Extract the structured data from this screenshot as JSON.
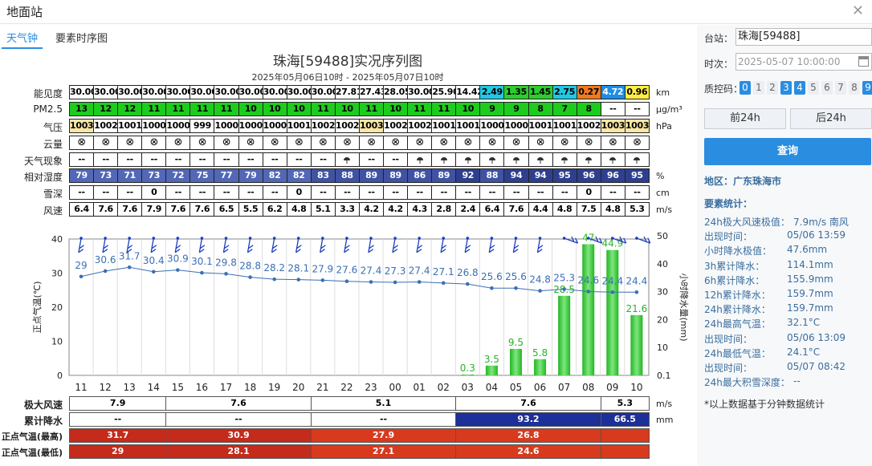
{
  "window": {
    "title": "地面站"
  },
  "tabs": [
    {
      "label": "天气钟",
      "active": true
    },
    {
      "label": "要素时序图",
      "active": false
    }
  ],
  "chart_header": {
    "title": "珠海[59488]实况序列图",
    "subtitle": "2025年05月06日10时 - 2025年05月07日10时"
  },
  "grid": {
    "visibility": {
      "label": "能见度",
      "unit": "km",
      "values": [
        "30.00",
        "30.00",
        "30.00",
        "30.00",
        "30.00",
        "30.00",
        "30.00",
        "30.00",
        "30.00",
        "30.00",
        "30.00",
        "27.81",
        "27.43",
        "28.05",
        "30.00",
        "25.90",
        "14.42",
        "2.49",
        "1.35",
        "1.45",
        "2.75",
        "0.27",
        "4.72",
        "0.96"
      ],
      "colors": [
        "#fff",
        "#fff",
        "#fff",
        "#fff",
        "#fff",
        "#fff",
        "#fff",
        "#fff",
        "#fff",
        "#fff",
        "#fff",
        "#fff",
        "#fff",
        "#fff",
        "#fff",
        "#fff",
        "#fff",
        "#22c7e3",
        "#2ecc2e",
        "#2ecc2e",
        "#22c7e3",
        "#ee7a1d",
        "#1e8de6",
        "#ffee44"
      ]
    },
    "pm25": {
      "label": "PM2.5",
      "unit": "μg/m³",
      "values": [
        "13",
        "12",
        "12",
        "11",
        "11",
        "11",
        "11",
        "10",
        "10",
        "10",
        "11",
        "10",
        "11",
        "10",
        "11",
        "11",
        "10",
        "9",
        "9",
        "8",
        "7",
        "8",
        "--",
        "--"
      ],
      "colors": [
        "#1ecc1e",
        "#1ecc1e",
        "#1ecc1e",
        "#1ecc1e",
        "#1ecc1e",
        "#1ecc1e",
        "#1ecc1e",
        "#1ecc1e",
        "#1ecc1e",
        "#1ecc1e",
        "#1ecc1e",
        "#1ecc1e",
        "#1ecc1e",
        "#1ecc1e",
        "#1ecc1e",
        "#1ecc1e",
        "#1ecc1e",
        "#1ecc1e",
        "#1ecc1e",
        "#1ecc1e",
        "#1ecc1e",
        "#1ecc1e",
        "#fff",
        "#fff"
      ]
    },
    "pressure": {
      "label": "气压",
      "unit": "hPa",
      "values": [
        "1003",
        "1002",
        "1001",
        "1000",
        "1000",
        "999",
        "1000",
        "1000",
        "1000",
        "1001",
        "1002",
        "1002",
        "1003",
        "1002",
        "1002",
        "1001",
        "1001",
        "1000",
        "1000",
        "1001",
        "1001",
        "1002",
        "1003",
        "1003"
      ],
      "colors": [
        "#f8e6a4",
        "#fff",
        "#fff",
        "#fff",
        "#fff",
        "#fff",
        "#fff",
        "#fff",
        "#fff",
        "#fff",
        "#fff",
        "#fff",
        "#f8e6a4",
        "#fff",
        "#fff",
        "#fff",
        "#fff",
        "#fff",
        "#fff",
        "#fff",
        "#fff",
        "#fff",
        "#f8e6a4",
        "#f8e6a4"
      ]
    },
    "cloud": {
      "label": "云量",
      "unit": "",
      "symbol": "⊗",
      "count": 24
    },
    "weather": {
      "label": "天气现象",
      "unit": "",
      "values": [
        "--",
        "--",
        "--",
        "--",
        "--",
        "--",
        "--",
        "--",
        "--",
        "--",
        "--",
        "rain",
        "--",
        "--",
        "rain",
        "rain",
        "rain",
        "rain",
        "rain",
        "rain",
        "rain",
        "rain",
        "rain",
        "rain"
      ]
    },
    "humidity": {
      "label": "相对湿度",
      "unit": "%",
      "values": [
        "79",
        "73",
        "71",
        "73",
        "72",
        "75",
        "77",
        "79",
        "82",
        "82",
        "83",
        "88",
        "89",
        "89",
        "86",
        "89",
        "92",
        "88",
        "94",
        "94",
        "95",
        "96",
        "96",
        "95"
      ],
      "colors": [
        "#5267b5",
        "#5267b5",
        "#5267b5",
        "#5267b5",
        "#5267b5",
        "#5267b5",
        "#5267b5",
        "#5267b5",
        "#5267b5",
        "#5267b5",
        "#3f52a3",
        "#3f52a3",
        "#3f52a3",
        "#3f52a3",
        "#3f52a3",
        "#3f52a3",
        "#2e3f8e",
        "#3f52a3",
        "#2e3f8e",
        "#2e3f8e",
        "#2e3f8e",
        "#2e3f8e",
        "#2e3f8e",
        "#2e3f8e"
      ]
    },
    "snow": {
      "label": "雪深",
      "unit": "cm",
      "values": [
        "--",
        "--",
        "--",
        "0",
        "--",
        "--",
        "--",
        "--",
        "--",
        "0",
        "--",
        "--",
        "--",
        "--",
        "--",
        "--",
        "--",
        "--",
        "--",
        "--",
        "--",
        "0",
        "--",
        "--"
      ]
    },
    "wind": {
      "label": "风速",
      "unit": "m/s",
      "values": [
        "6.4",
        "7.6",
        "7.6",
        "7.9",
        "7.6",
        "7.6",
        "6.5",
        "5.5",
        "6.2",
        "4.8",
        "5.1",
        "3.3",
        "4.2",
        "4.2",
        "4.3",
        "2.8",
        "2.4",
        "6.4",
        "7.6",
        "4.4",
        "4.8",
        "7.5",
        "4.8",
        "5.3"
      ]
    }
  },
  "chart_data": {
    "type": "line",
    "x": [
      "11",
      "12",
      "13",
      "14",
      "15",
      "16",
      "17",
      "18",
      "19",
      "20",
      "21",
      "22",
      "23",
      "00",
      "01",
      "02",
      "03",
      "04",
      "05",
      "06",
      "07",
      "08",
      "09",
      "10"
    ],
    "ylabel": "正点气温(℃)",
    "y2label": "小时降水量(mm)",
    "ylim": [
      0,
      40
    ],
    "y_ticks": [
      "0",
      "10",
      "20",
      "30",
      "40"
    ],
    "y2_ticks": [
      "0.1",
      "10",
      "20",
      "30",
      "40",
      "50"
    ],
    "series": [
      {
        "values": [
          29,
          30.6,
          31.7,
          30.4,
          30.9,
          30.1,
          29.8,
          28.8,
          28.2,
          28.1,
          27.9,
          27.6,
          27.4,
          27.3,
          27.4,
          27.1,
          26.8,
          25.6,
          25.6,
          24.8,
          25.3,
          24.6,
          24.4,
          24.4
        ],
        "color": "#3a6fb4"
      },
      {
        "type": "bar",
        "values": [
          null,
          null,
          null,
          null,
          null,
          null,
          null,
          null,
          null,
          null,
          null,
          null,
          null,
          null,
          null,
          null,
          0.3,
          3.5,
          9.5,
          5.8,
          28.5,
          47,
          44.9,
          21.6
        ],
        "color": "#2ec82e"
      }
    ],
    "grid": true
  },
  "bottom": {
    "rows": [
      {
        "label": "极大风速",
        "cells": [
          {
            "text": "7.9",
            "bg": "#fff",
            "fg": "#000"
          },
          {
            "text": "7.6",
            "bg": "#fff",
            "fg": "#000"
          },
          {
            "text": "5.1",
            "bg": "#fff",
            "fg": "#000"
          },
          {
            "text": "7.6",
            "bg": "#fff",
            "fg": "#000"
          },
          {
            "text": "5.3",
            "bg": "#fff",
            "fg": "#000"
          }
        ],
        "unit": "m/s"
      },
      {
        "label": "累计降水",
        "cells": [
          {
            "text": "--",
            "bg": "#fff",
            "fg": "#000"
          },
          {
            "text": "--",
            "bg": "#fff",
            "fg": "#000"
          },
          {
            "text": "--",
            "bg": "#fff",
            "fg": "#000"
          },
          {
            "text": "93.2",
            "bg": "#1d2f98",
            "fg": "#fff"
          },
          {
            "text": "66.5",
            "bg": "#1d2f98",
            "fg": "#fff"
          }
        ],
        "unit": "mm"
      },
      {
        "label": "正点气温(最高)",
        "cells": [
          {
            "text": "31.7",
            "bg": "#c42b1c",
            "fg": "#fff"
          },
          {
            "text": "30.9",
            "bg": "#c42b1c",
            "fg": "#fff"
          },
          {
            "text": "27.9",
            "bg": "#d83a1e",
            "fg": "#fff"
          },
          {
            "text": "26.8",
            "bg": "#d83a1e",
            "fg": "#fff"
          },
          {
            "text": "",
            "bg": "#d83a1e",
            "fg": "#fff"
          }
        ],
        "unit": ""
      },
      {
        "label": "正点气温(最低)",
        "cells": [
          {
            "text": "29",
            "bg": "#c42b1c",
            "fg": "#fff"
          },
          {
            "text": "28.1",
            "bg": "#c42b1c",
            "fg": "#fff"
          },
          {
            "text": "27.1",
            "bg": "#d83a1e",
            "fg": "#fff"
          },
          {
            "text": "24.6",
            "bg": "#d83a1e",
            "fg": "#fff"
          },
          {
            "text": "",
            "bg": "#d83a1e",
            "fg": "#fff"
          }
        ],
        "unit": ""
      }
    ]
  },
  "sidebar": {
    "station_label": "台站：",
    "station_value": "珠海[59488]",
    "time_label": "时次：",
    "time_value": "2025-05-07 10:00:00",
    "qc_label": "质控码：",
    "qc_codes": [
      {
        "v": "0",
        "on": true
      },
      {
        "v": "1",
        "on": false
      },
      {
        "v": "2",
        "on": false
      },
      {
        "v": "3",
        "on": true
      },
      {
        "v": "4",
        "on": true
      },
      {
        "v": "5",
        "on": false
      },
      {
        "v": "6",
        "on": false
      },
      {
        "v": "7",
        "on": false
      },
      {
        "v": "8",
        "on": false
      },
      {
        "v": "9",
        "on": true
      }
    ],
    "prev_label": "前24h",
    "next_label": "后24h",
    "query_label": "查询",
    "region": "地区：广东珠海市",
    "stats_title": "要素统计：",
    "stats": [
      {
        "k": "24h极大风速极值：",
        "v": "7.9m/s 南风"
      },
      {
        "k": "出现时间：",
        "v": "05/06 13:59"
      },
      {
        "k": "小时降水极值：",
        "v": "47.6mm"
      },
      {
        "k": "3h累计降水：",
        "v": "114.1mm"
      },
      {
        "k": "6h累计降水：",
        "v": "155.9mm"
      },
      {
        "k": "12h累计降水：",
        "v": "159.7mm"
      },
      {
        "k": "24h累计降水：",
        "v": "159.7mm"
      },
      {
        "k": "24h最高气温：",
        "v": "32.1°C"
      },
      {
        "k": "出现时间：",
        "v": "05/06 13:09"
      },
      {
        "k": "24h最低气温：",
        "v": "24.1°C"
      },
      {
        "k": "出现时间：",
        "v": "05/07 08:42"
      },
      {
        "k": "24h最大积雪深度：",
        "v": "--"
      }
    ],
    "footnote": "*以上数据基于分钟数据统计"
  }
}
